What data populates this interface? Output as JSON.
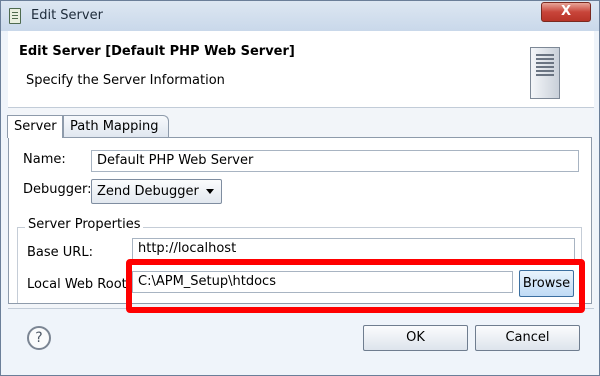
{
  "window": {
    "title": "Edit Server",
    "close_label": "X"
  },
  "header": {
    "title": "Edit Server [Default PHP Web Server]",
    "description": "Specify the Server Information"
  },
  "tabs": [
    {
      "label": "Server",
      "active": true
    },
    {
      "label": "Path Mapping",
      "active": false
    }
  ],
  "form": {
    "name_label": "Name:",
    "name_value": "Default PHP Web Server",
    "debugger_label": "Debugger:",
    "debugger_value": "Zend Debugger",
    "group_label": "Server Properties",
    "base_url_label": "Base URL:",
    "base_url_value": "http://localhost",
    "web_root_label": "Local Web Root:",
    "web_root_value": "C:\\APM_Setup\\htdocs",
    "browse_label": "Browse"
  },
  "buttons": {
    "help": "?",
    "ok": "OK",
    "cancel": "Cancel"
  },
  "colors": {
    "highlight": "#ff0000",
    "window_bg": "#eff4fa"
  },
  "icons": [
    "app-icon",
    "server-icon",
    "help-icon",
    "dropdown-arrow-icon"
  ]
}
